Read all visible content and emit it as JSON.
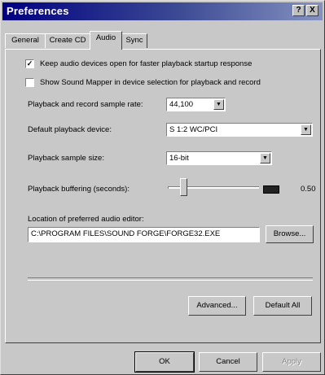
{
  "window": {
    "title": "Preferences",
    "help_label": "?",
    "close_label": "X"
  },
  "tabs": [
    {
      "label": "General",
      "active": false
    },
    {
      "label": "Create CD",
      "active": false
    },
    {
      "label": "Audio",
      "active": true
    },
    {
      "label": "Sync",
      "active": false
    }
  ],
  "options": {
    "keep_open": {
      "label": "Keep audio devices open for faster playback startup response",
      "checked": true
    },
    "sound_mapper": {
      "label": "Show Sound Mapper in device selection for playback and record",
      "checked": false
    }
  },
  "sample_rate": {
    "label": "Playback and record sample rate:",
    "value": "44,100"
  },
  "default_device": {
    "label": "Default playback device:",
    "value": "S 1:2 WC/PCI"
  },
  "sample_size": {
    "label": "Playback sample size:",
    "value": "16-bit"
  },
  "buffering": {
    "label": "Playback buffering (seconds):",
    "value_text": "0.50",
    "slider_fraction": 0.15
  },
  "editor": {
    "label": "Location of preferred audio editor:",
    "path": "C:\\PROGRAM FILES\\SOUND FORGE\\FORGE32.EXE",
    "browse_label": "Browse..."
  },
  "panel_buttons": {
    "advanced": "Advanced...",
    "default_all": "Default All"
  },
  "dialog_buttons": {
    "ok": "OK",
    "cancel": "Cancel",
    "apply": "Apply"
  }
}
